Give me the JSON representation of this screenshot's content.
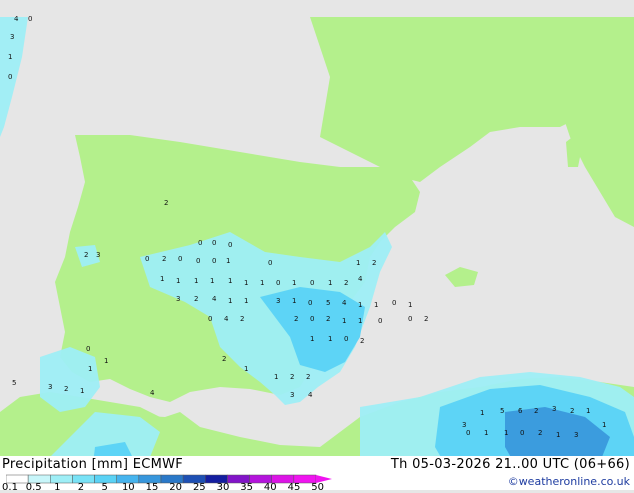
{
  "map": {
    "land_color": "#b4f08c",
    "sea_color": "#e6e6e6",
    "precip_light": "#9eeef6",
    "precip_medium": "#5ad2f5",
    "precip_heavy": "#3796dc",
    "precip_values": [
      "4",
      "0",
      "3",
      "1",
      "0",
      "2",
      "0",
      "0",
      "0",
      "0",
      "2",
      "0",
      "0",
      "0",
      "1",
      "0",
      "1",
      "2",
      "2",
      "3",
      "1",
      "1",
      "1",
      "1",
      "1",
      "1",
      "1",
      "0",
      "1",
      "0",
      "1",
      "2",
      "4",
      "3",
      "2",
      "4",
      "1",
      "1",
      "3",
      "1",
      "0",
      "5",
      "4",
      "1",
      "1",
      "0",
      "1",
      "0",
      "4",
      "2",
      "2",
      "0",
      "2",
      "1",
      "1",
      "0",
      "0",
      "2",
      "1",
      "1",
      "0",
      "2",
      "0",
      "1",
      "1",
      "2",
      "1",
      "1",
      "2",
      "2",
      "3",
      "4",
      "5",
      "3",
      "2",
      "1",
      "4",
      "3",
      "1",
      "5",
      "6",
      "2",
      "3",
      "2",
      "1",
      "1",
      "0",
      "1",
      "1",
      "0",
      "2",
      "1",
      "3"
    ]
  },
  "footer": {
    "title_left": "Precipitation [mm]  ECMWF",
    "title_right": "Th 05-03-2026 21..00 UTC (06+66)",
    "credit": "©weatheronline.co.uk",
    "scale_labels": [
      "0.1",
      "0.5",
      "1",
      "2",
      "5",
      "10",
      "15",
      "20",
      "25",
      "30",
      "35",
      "40",
      "45",
      "50"
    ],
    "scale_colors": [
      "#ffffff",
      "#c8f6fa",
      "#9eeef6",
      "#78e2f6",
      "#5ad2f5",
      "#46b4ee",
      "#3796dc",
      "#2a78c8",
      "#1e50b4",
      "#141ea0",
      "#8214c8",
      "#b414dc",
      "#dc14e6",
      "#f014f0"
    ]
  }
}
